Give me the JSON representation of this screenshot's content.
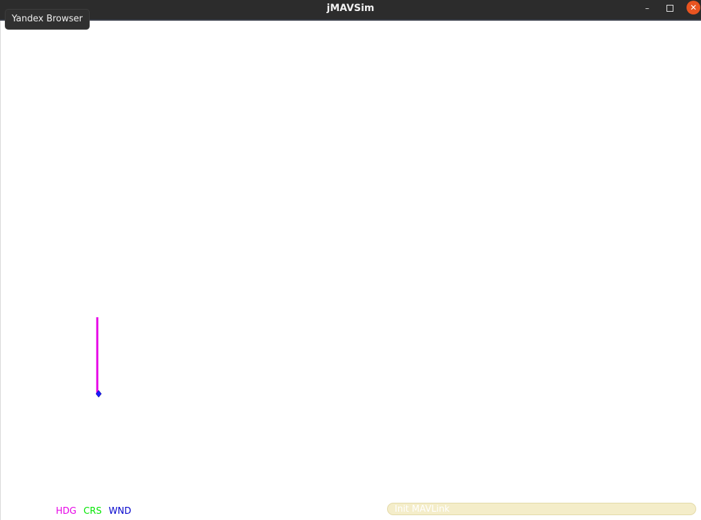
{
  "window": {
    "title": "jMAVSim",
    "controls": {
      "minimize_glyph": "–",
      "maximize_icon": "maximize-icon",
      "close_glyph": "✕"
    }
  },
  "tooltip": {
    "text": "Yandex Browser"
  },
  "hud": {
    "legend": [
      {
        "label": "HDG",
        "color": "#e600e6"
      },
      {
        "label": "CRS",
        "color": "#00e600"
      },
      {
        "label": "WND",
        "color": "#0000cc"
      }
    ],
    "heading_vector_color": "#e600e6",
    "vehicle_marker_color": "#1a1aff"
  },
  "status": {
    "message": "Init MAVLink"
  },
  "colors": {
    "titlebar": "#2c2c2c",
    "close_button": "#e95420",
    "status_bg": "#f4edc9"
  }
}
